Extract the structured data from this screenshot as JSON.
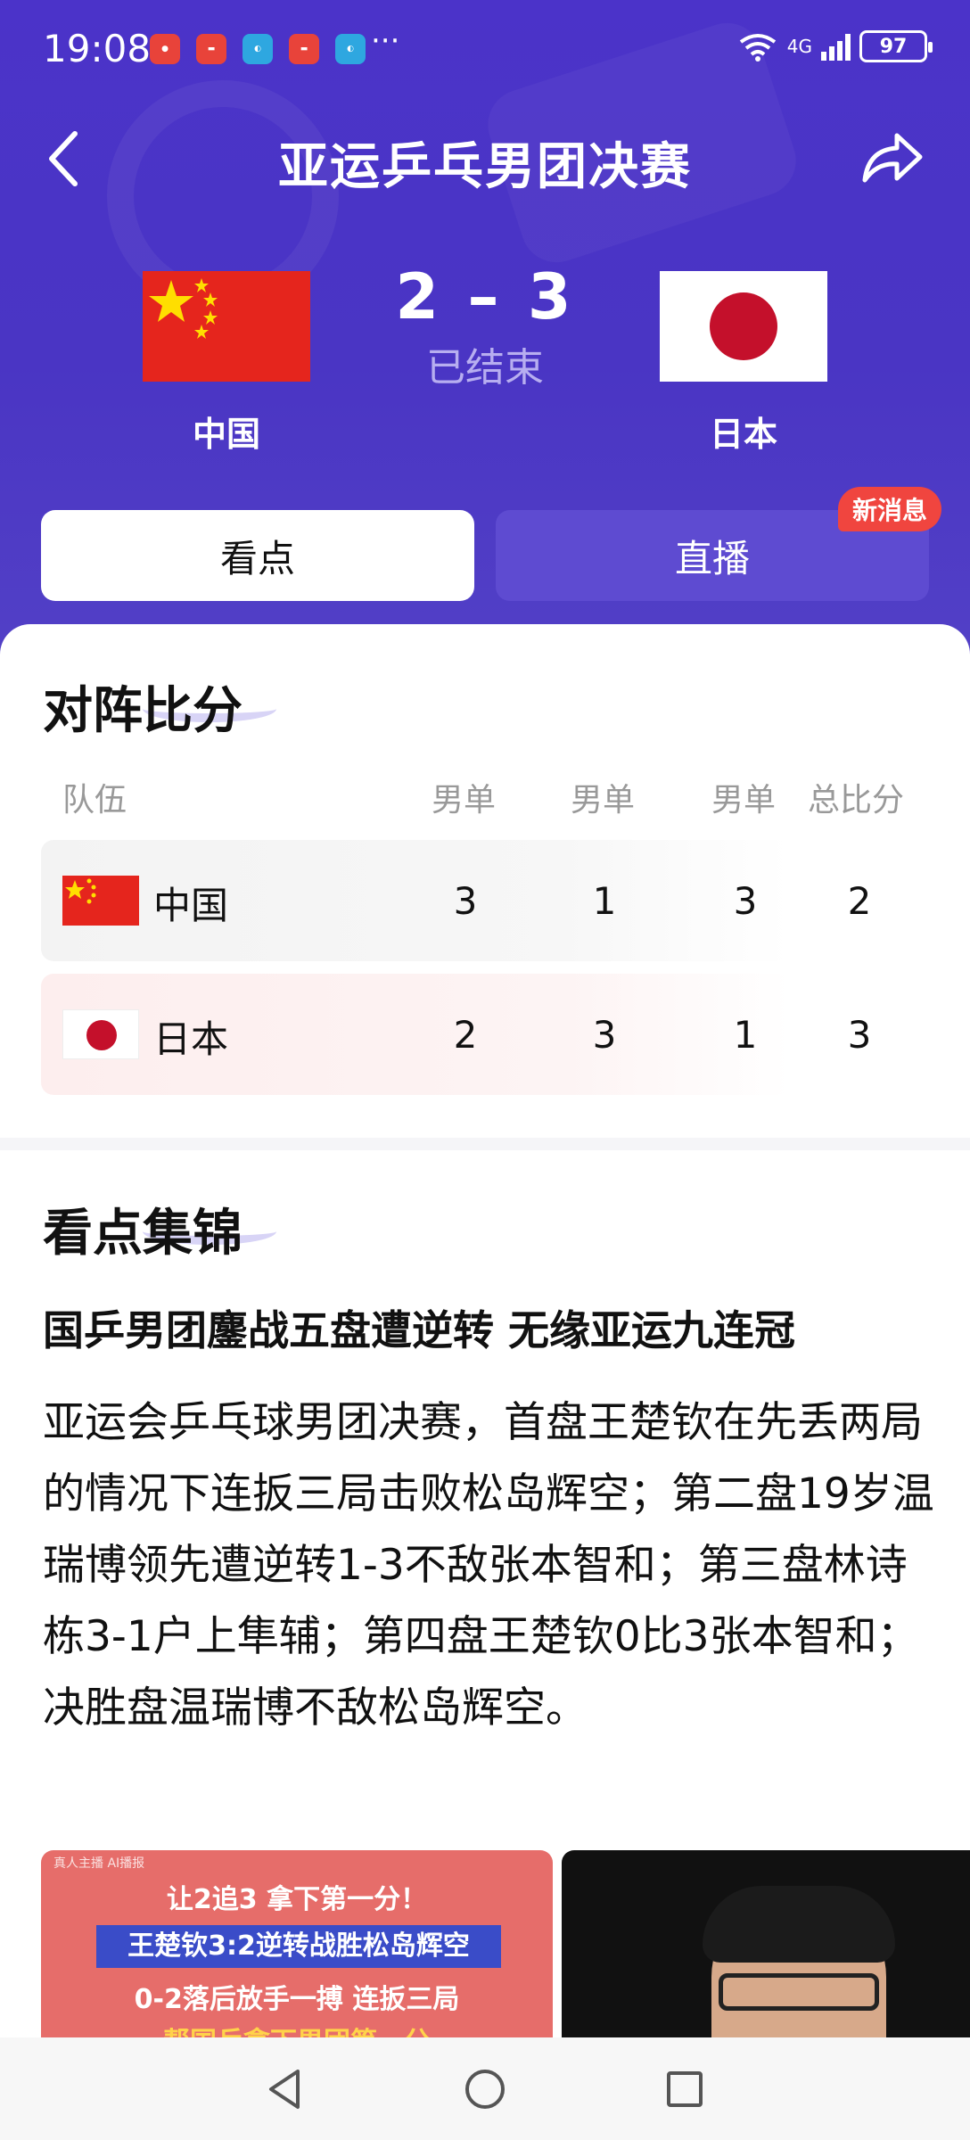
{
  "status_bar": {
    "time": "19:08",
    "battery": "97",
    "network": "4G",
    "more": "···"
  },
  "header": {
    "title": "亚运乒乓男团决赛"
  },
  "match": {
    "home_team": "中国",
    "away_team": "日本",
    "score": "2 – 3",
    "status": "已结束"
  },
  "tabs": [
    {
      "label": "看点",
      "active": true
    },
    {
      "label": "直播",
      "active": false,
      "badge": "新消息"
    }
  ],
  "lineup": {
    "title": "对阵比分",
    "columns": [
      "队伍",
      "男单",
      "男单",
      "男单",
      "总比分"
    ],
    "rows": [
      {
        "team": "中国",
        "scores": [
          "3",
          "1",
          "3"
        ],
        "total": "2"
      },
      {
        "team": "日本",
        "scores": [
          "2",
          "3",
          "1"
        ],
        "total": "3"
      }
    ]
  },
  "highlights": {
    "title": "看点集锦",
    "headline": "国乒男团鏖战五盘遭逆转 无缘亚运九连冠",
    "body": "亚运会乒乓球男团决赛，首盘王楚钦在先丢两局的情况下连扳三局击败松岛辉空；第二盘19岁温瑞博领先遭逆转1-3不敌张本智和；第三盘林诗栋3-1户上隼辅；第四盘王楚钦0比3张本智和；决胜盘温瑞博不敌松岛辉空。",
    "video1": {
      "tag": "真人主播 AI播报",
      "line1": "让2追3 拿下第一分！",
      "line2": "王楚钦3:2逆转战胜松岛辉空",
      "line3": "0-2落后放手一搏 连扳三局",
      "line4": "帮国乒拿下男团第一分"
    }
  },
  "colors": {
    "header_bg": "#4b33c9",
    "badge": "#f0453f",
    "china_red": "#e5251d",
    "japan_red": "#c4102b"
  }
}
